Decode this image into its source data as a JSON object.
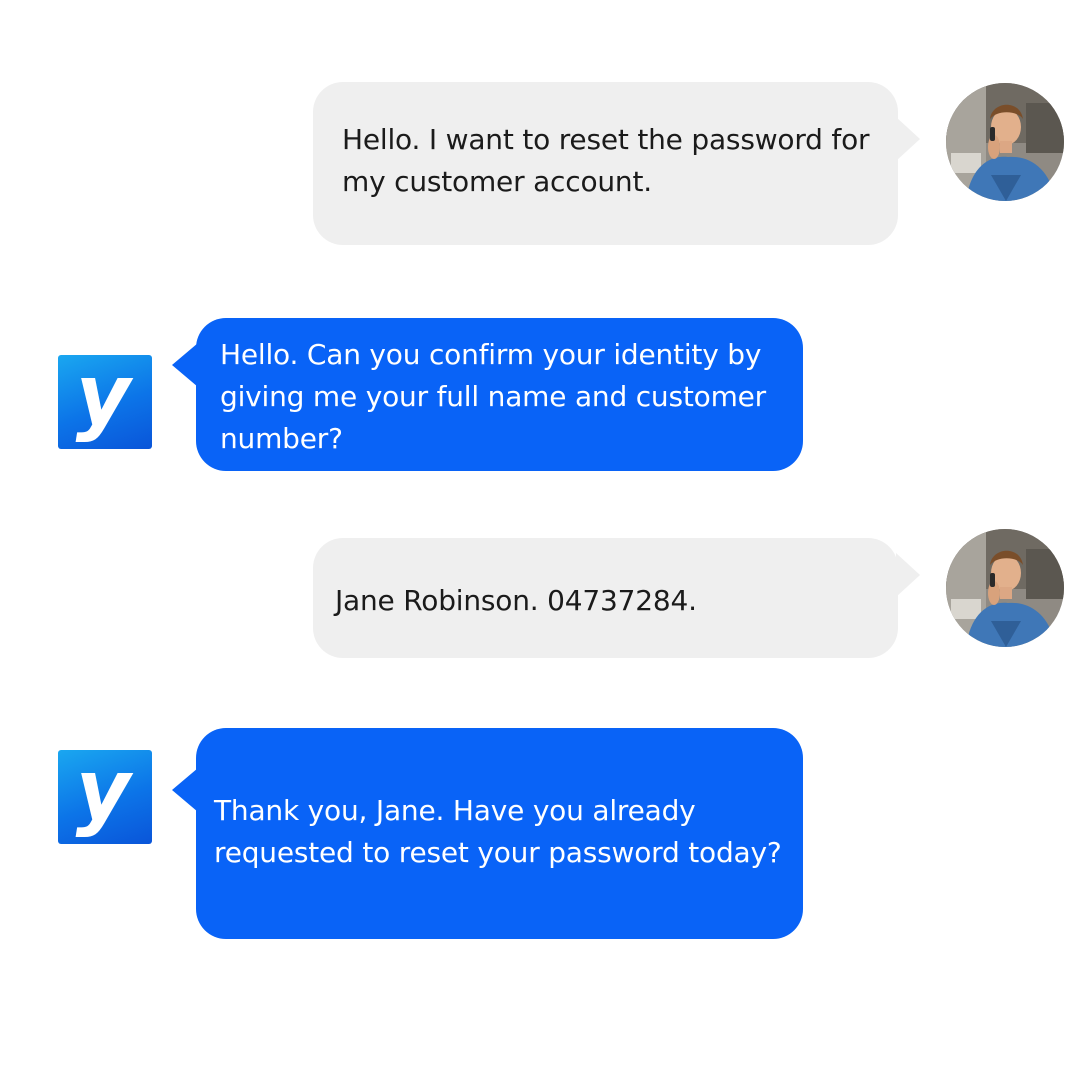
{
  "conversation": {
    "messages": [
      {
        "sender": "user",
        "text": "Hello. I want to reset the password for\nmy customer account."
      },
      {
        "sender": "bot",
        "text": "Hello. Can you confirm your identity by\ngiving me your full name and customer\nnumber?"
      },
      {
        "sender": "user",
        "text": "Jane Robinson. 04737284."
      },
      {
        "sender": "bot",
        "text": "Thank you, Jane. Have you already\nrequested to reset your password today?"
      }
    ]
  },
  "bot": {
    "logo_letter": "y",
    "logo_color": "#0c74e8"
  },
  "colors": {
    "user_bubble": "#efefef",
    "bot_bubble": "#0963f7",
    "user_text": "#1b1b1b",
    "bot_text": "#ffffff"
  },
  "icons": {
    "user_avatar": "user-avatar-photo",
    "bot_avatar": "bot-logo-icon"
  }
}
